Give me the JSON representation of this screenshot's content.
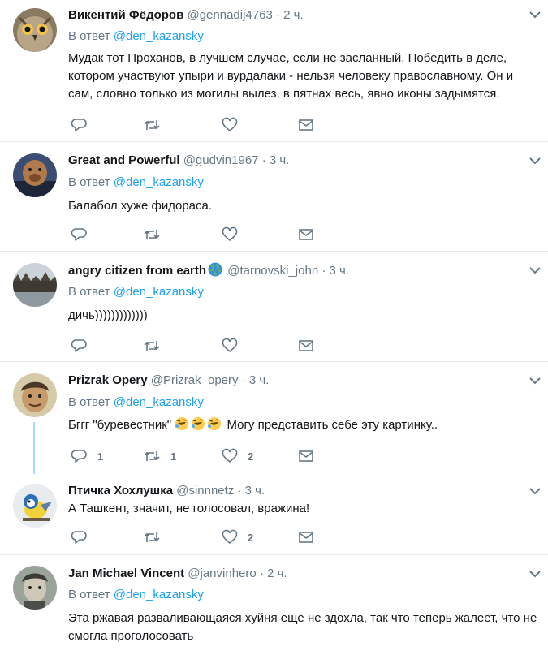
{
  "reply_prefix": "В ответ",
  "tweets": [
    {
      "name": "Викентий Фёдоров",
      "handle": "@gennadij4763",
      "dot": "·",
      "time": "2 ч.",
      "mention": "@den_kazansky",
      "text": "Мудак тот Проханов, в лучшем случае, если не засланный. Победить в деле, котором участвуют упыри и вурдалаки - нельзя человеку православному. Он и сам, словно только из могилы вылез, в пятнах весь, явно иконы задымятся.",
      "reply_count": "",
      "retweet_count": "",
      "like_count": ""
    },
    {
      "name": "Great and Powerful",
      "handle": "@gudvin1967",
      "dot": "·",
      "time": "3 ч.",
      "mention": "@den_kazansky",
      "text": "Балабол хуже фидораса.",
      "reply_count": "",
      "retweet_count": "",
      "like_count": ""
    },
    {
      "name": "angry citizen from earth",
      "handle": "@tarnovski_john",
      "dot": "·",
      "time": "3 ч.",
      "mention": "@den_kazansky",
      "text": "дичь)))))))))))))",
      "reply_count": "",
      "retweet_count": "",
      "like_count": ""
    },
    {
      "name": "Prizrak Opery",
      "handle": "@Prizrak_opery",
      "dot": "·",
      "time": "3 ч.",
      "mention": "@den_kazansky",
      "text_before": "Бггг \"буревестник\"",
      "text_after": "Могу представить себе эту картинку..",
      "reply_count": "1",
      "retweet_count": "1",
      "like_count": "2"
    },
    {
      "name": "Птичка Хохлушка",
      "handle": "@sinnnetz",
      "dot": "·",
      "time": "3 ч.",
      "text": "А Ташкент, значит, не голосовал, вражина!",
      "reply_count": "",
      "retweet_count": "",
      "like_count": "2"
    },
    {
      "name": "Jan Michael Vincent",
      "handle": "@janvinhero",
      "dot": "·",
      "time": "2 ч.",
      "mention": "@den_kazansky",
      "text": "Эта ржавая разваливающаяся хуйня ещё не здохла, так что теперь жалеет, что не смогла проголосовать"
    }
  ]
}
